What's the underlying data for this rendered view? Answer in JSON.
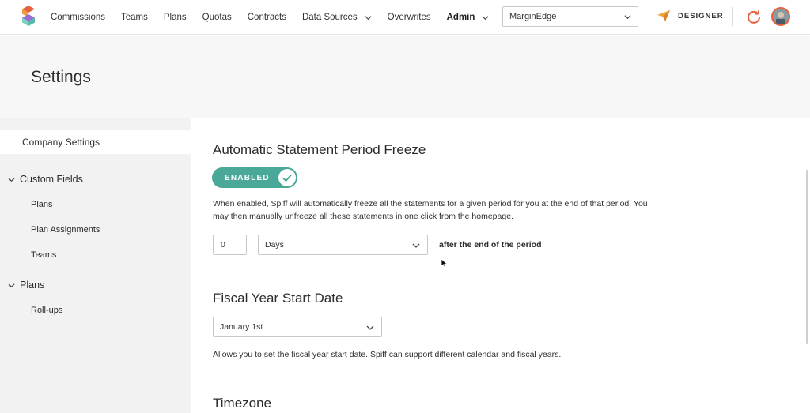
{
  "nav": {
    "items": [
      {
        "label": "Commissions"
      },
      {
        "label": "Teams"
      },
      {
        "label": "Plans"
      },
      {
        "label": "Quotas"
      },
      {
        "label": "Contracts"
      },
      {
        "label": "Data Sources"
      },
      {
        "label": "Overwrites"
      },
      {
        "label": "Admin"
      }
    ],
    "org_select_value": "MarginEdge",
    "designer_label": "DESIGNER"
  },
  "page": {
    "title": "Settings"
  },
  "sidebar": {
    "company_settings": "Company Settings",
    "custom_fields": "Custom Fields",
    "custom_fields_items": [
      "Plans",
      "Plan Assignments",
      "Teams"
    ],
    "plans": "Plans",
    "plans_items": [
      "Roll-ups"
    ]
  },
  "freeze": {
    "title": "Automatic Statement Period Freeze",
    "toggle_label": "ENABLED",
    "help_line1": "When enabled, Spiff will automatically freeze all the statements for a given period for you at the end of that period. You",
    "help_line2": "may then manually unfreeze all these statements in one click from the homepage.",
    "count_value": "0",
    "unit_value": "Days",
    "after_text": "after the end of the period"
  },
  "fiscal": {
    "title": "Fiscal Year Start Date",
    "value": "January 1st",
    "help": "Allows you to set the fiscal year start date. Spiff can support different calendar and fiscal years."
  },
  "timezone": {
    "title": "Timezone"
  },
  "colors": {
    "accent": "#4aa899",
    "brand_orange": "#e8603c"
  }
}
